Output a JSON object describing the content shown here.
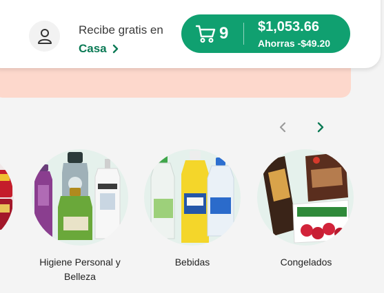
{
  "header": {
    "delivery_label": "Recibe gratis en",
    "delivery_destination": "Casa",
    "user_icon": "user-icon",
    "chevron_icon": "chevron-right-icon"
  },
  "cart": {
    "icon": "cart-icon",
    "count": "9",
    "total": "$1,053.66",
    "savings": "Ahorras -$49.20"
  },
  "carousel": {
    "prev_icon": "chevron-left-icon",
    "next_icon": "chevron-right-icon",
    "categories": [
      {
        "label": "Higiene Personal y Belleza"
      },
      {
        "label": "Bebidas"
      },
      {
        "label": "Congelados"
      }
    ]
  },
  "colors": {
    "brand_green": "#10a070",
    "dark_green": "#0b7a55",
    "banner_pink": "#fdd8cc",
    "circle_mint": "#e5f1ec"
  }
}
